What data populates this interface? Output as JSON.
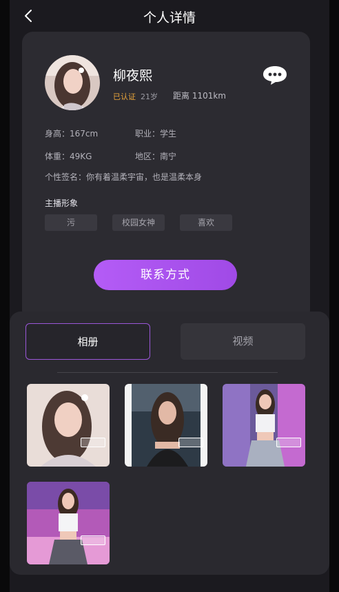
{
  "header": {
    "title": "个人详情"
  },
  "profile": {
    "name": "柳夜熙",
    "verified_label": "已认证",
    "age": "21岁",
    "distance": "距离 1101km",
    "height": "身高：167cm",
    "occupation": "职业：学生",
    "weight": "体重：49KG",
    "region": "地区：南宁",
    "signature": "个性签名：你有着温柔宇宙，也是温柔本身",
    "tags_title": "主播形象",
    "tags": [
      "污",
      "校园女神",
      "喜欢"
    ],
    "contact_label": "联系方式"
  },
  "gallery": {
    "tabs": [
      {
        "label": "相册",
        "active": true
      },
      {
        "label": "视频",
        "active": false
      }
    ],
    "photos": [
      {
        "name": "photo-1",
        "scene": "selfie-light"
      },
      {
        "name": "photo-2",
        "scene": "selfie-dark"
      },
      {
        "name": "photo-3",
        "scene": "stage-neon"
      },
      {
        "name": "photo-4",
        "scene": "stage-pink"
      }
    ]
  },
  "colors": {
    "accent": "#a855f7",
    "verified": "#e9a53b",
    "card_bg": "#2c2b31",
    "page_bg": "#1b1a1f"
  }
}
